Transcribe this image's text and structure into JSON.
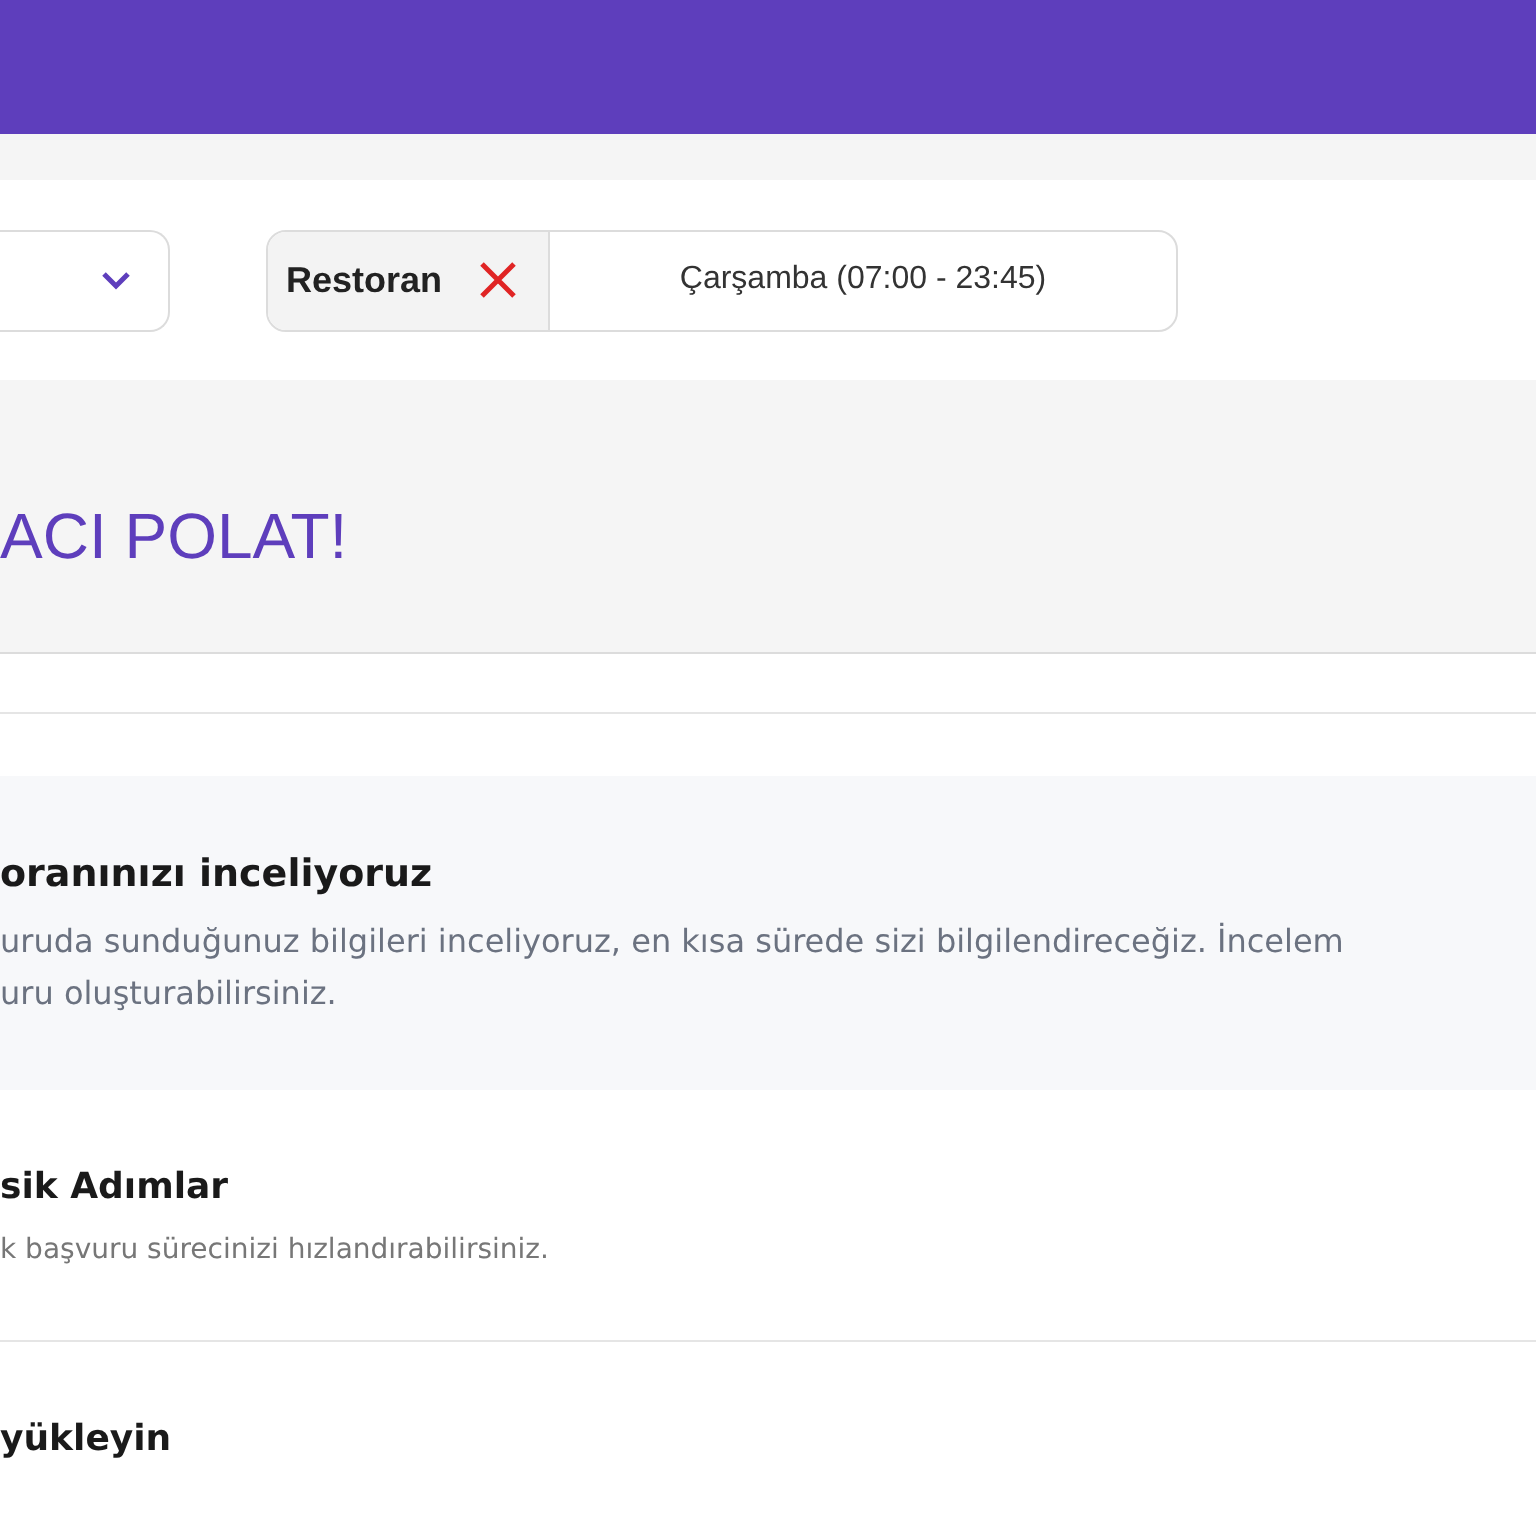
{
  "tag": {
    "label": "Restoran"
  },
  "schedule": "Çarşamba (07:00 - 23:45)",
  "greeting": "ACI POLAT!",
  "notice": {
    "title": "oranınızı inceliyoruz",
    "lines": [
      "uruda sunduğunuz bilgileri inceliyoruz, en kısa sürede sizi bilgilendireceğiz. İncelem",
      "uru oluşturabilirsiniz."
    ]
  },
  "steps": [
    {
      "title": "sik Adımlar",
      "subtitle": "k başvuru sürecinizi hızlandırabilirsiniz."
    },
    {
      "title": "yükleyin"
    }
  ]
}
